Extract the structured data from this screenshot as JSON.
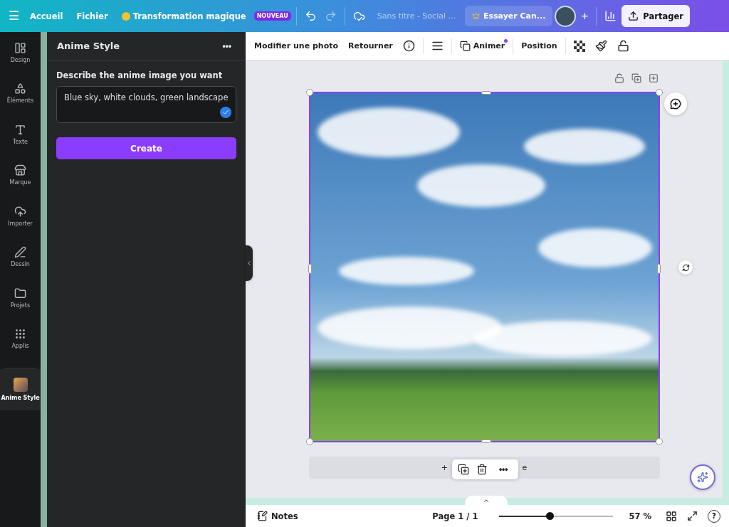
{
  "topbar": {
    "items": [
      {
        "kind": "menu",
        "label": "☰"
      },
      {
        "kind": "link",
        "label": "Accueil"
      },
      {
        "kind": "link",
        "label": "Fichier"
      },
      {
        "kind": "magic",
        "label": "Transformation magique",
        "badge": "NOUVEAU"
      }
    ],
    "title": "Sans titre - Social ...",
    "trial": "Essayer Can...",
    "add": "+",
    "share": "Partager"
  },
  "sidebar": {
    "items": [
      {
        "kind": "tool",
        "label": "Design",
        "selected": false
      },
      {
        "kind": "tool",
        "label": "Éléments",
        "selected": false
      },
      {
        "kind": "tool",
        "label": "Texte",
        "selected": false
      },
      {
        "kind": "tool",
        "label": "Marque",
        "selected": false
      },
      {
        "kind": "tool",
        "label": "Importer",
        "selected": false
      },
      {
        "kind": "tool",
        "label": "Dessin",
        "selected": false
      },
      {
        "kind": "tool",
        "label": "Projets",
        "selected": false
      },
      {
        "kind": "tool",
        "label": "Applis",
        "selected": false
      },
      {
        "kind": "app",
        "label": "Anime Style",
        "selected": true
      }
    ]
  },
  "panel": {
    "title": "Anime Style",
    "more": "•••",
    "prompt_label": "Describe the anime image you want",
    "prompt_value": "Blue sky, white clouds, green landscape",
    "button": "Create"
  },
  "toolbar": {
    "items": [
      {
        "kind": "text",
        "label": "Modifier une photo"
      },
      {
        "kind": "text",
        "label": "Retourner"
      },
      {
        "kind": "icon"
      },
      {
        "kind": "divider"
      },
      {
        "kind": "icon"
      },
      {
        "kind": "divider"
      },
      {
        "kind": "animate",
        "label": "Animer"
      },
      {
        "kind": "divider"
      },
      {
        "kind": "text",
        "label": "Position"
      },
      {
        "kind": "divider"
      },
      {
        "kind": "icon"
      },
      {
        "kind": "icon"
      },
      {
        "kind": "icon"
      }
    ]
  },
  "add_page": {
    "left": "+",
    "right": "e"
  },
  "popup": {
    "more": "•••"
  },
  "footer": {
    "notes": "Notes",
    "page": "Page 1 / 1",
    "zoom": {
      "level": 0.44
    },
    "zoom_reading": "57 %",
    "help": "?"
  }
}
